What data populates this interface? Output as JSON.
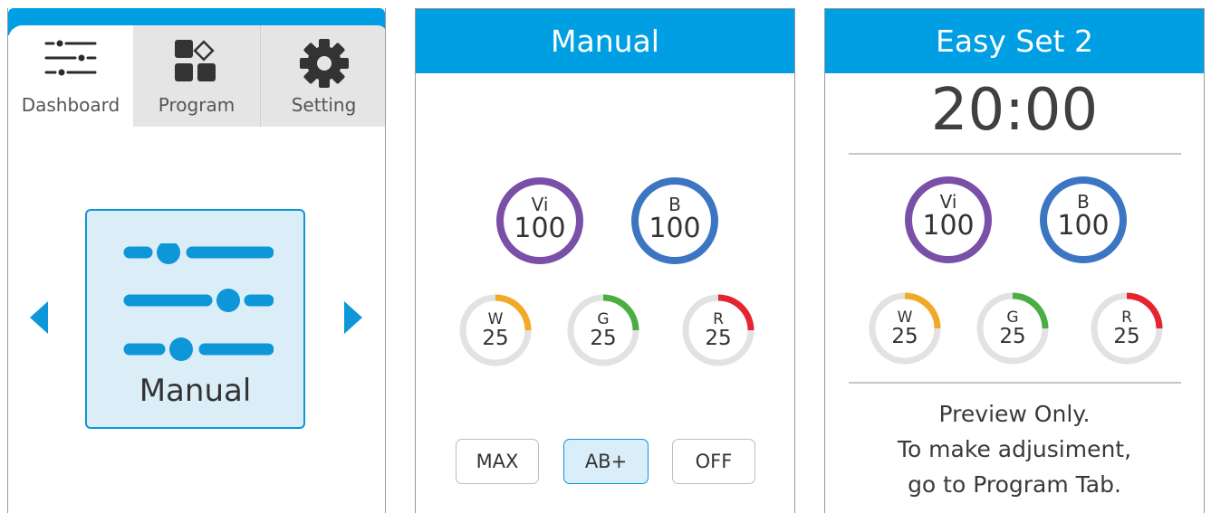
{
  "dashboard": {
    "tabs": [
      {
        "label": "Dashboard",
        "icon": "sliders-icon",
        "active": true
      },
      {
        "label": "Program",
        "icon": "blocks-icon",
        "active": false
      },
      {
        "label": "Setting",
        "icon": "gear-icon",
        "active": false
      }
    ],
    "card_label": "Manual",
    "card_icon": "sliders-icon",
    "nav_prev_icon": "chevron-left-icon",
    "nav_next_icon": "chevron-right-icon"
  },
  "manual": {
    "title": "Manual",
    "channels_large": [
      {
        "name": "Vi",
        "value": "100",
        "color": "#7a4fa8"
      },
      {
        "name": "B",
        "value": "100",
        "color": "#3c75c1"
      }
    ],
    "channels_small": [
      {
        "name": "W",
        "value": "25",
        "color": "#f2a928",
        "level": 0.25
      },
      {
        "name": "G",
        "value": "25",
        "color": "#4cad42",
        "level": 0.25
      },
      {
        "name": "R",
        "value": "25",
        "color": "#e42530",
        "level": 0.25
      }
    ],
    "buttons": [
      {
        "label": "MAX"
      },
      {
        "label": "AB+",
        "selected": true
      },
      {
        "label": "OFF"
      }
    ]
  },
  "easyset": {
    "title": "Easy Set 2",
    "time": "20:00",
    "channels_large": [
      {
        "name": "Vi",
        "value": "100"
      },
      {
        "name": "B",
        "value": "100"
      }
    ],
    "channels_small": [
      {
        "name": "W",
        "value": "25"
      },
      {
        "name": "G",
        "value": "25"
      },
      {
        "name": "R",
        "value": "25"
      }
    ],
    "preview_lines": [
      "Preview Only.",
      "To make adjusiment,",
      "go to Program Tab."
    ]
  },
  "colors": {
    "accent": "#009fe3",
    "violet": "#7a4fa8",
    "blue": "#3c75c1",
    "white_ch": "#f2a928",
    "green_ch": "#4cad42",
    "red_ch": "#e42530",
    "ring_track": "#e2e2e2"
  }
}
